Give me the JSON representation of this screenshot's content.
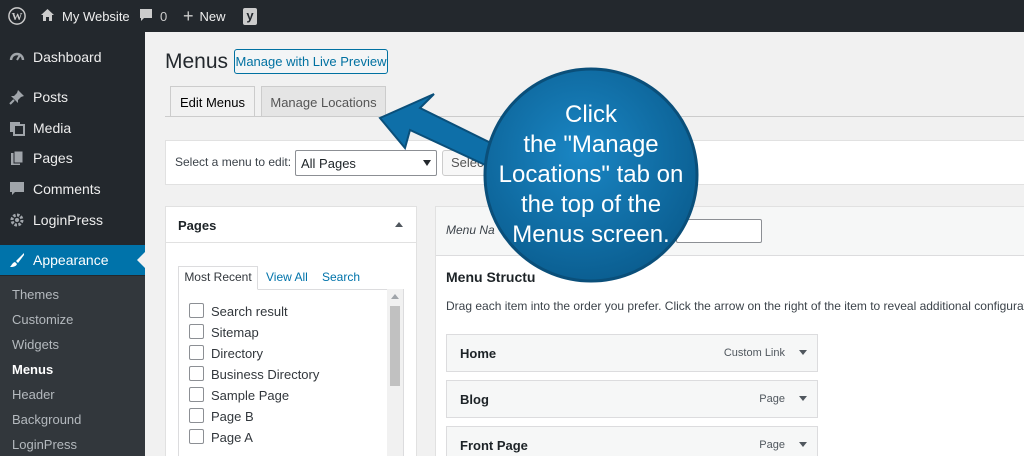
{
  "adminbar": {
    "site_name": "My Website",
    "comments_count": "0",
    "new_label": "New",
    "yoast_label": "y"
  },
  "sidebar": {
    "items": [
      {
        "label": "Dashboard",
        "icon": "dashboard-icon"
      },
      {
        "label": "Posts",
        "icon": "pin-icon"
      },
      {
        "label": "Media",
        "icon": "media-icon"
      },
      {
        "label": "Pages",
        "icon": "pages-icon"
      },
      {
        "label": "Comments",
        "icon": "comment-icon"
      },
      {
        "label": "LoginPress",
        "icon": "gear-icon"
      },
      {
        "label": "Appearance",
        "icon": "brush-icon"
      }
    ],
    "submenu": [
      "Themes",
      "Customize",
      "Widgets",
      "Menus",
      "Header",
      "Background",
      "LoginPress"
    ],
    "active_color": "#0073aa"
  },
  "main": {
    "title": "Menus",
    "live_preview_button": "Manage with Live Preview",
    "tabs": [
      "Edit Menus",
      "Manage Locations"
    ],
    "select_label": "Select a menu to edit:",
    "select_value": "All Pages",
    "select_button": "Select"
  },
  "pages_panel": {
    "title": "Pages",
    "tabs": [
      "Most Recent",
      "View All",
      "Search"
    ],
    "pages": [
      "Search result",
      "Sitemap",
      "Directory",
      "Business Directory",
      "Sample Page",
      "Page B",
      "Page A"
    ]
  },
  "menu_panel": {
    "menu_name_label": "Menu Na",
    "structure_title": "Menu Structu",
    "instructions": "Drag each item into the order you prefer. Click the arrow on the right of the item to reveal additional configuratio",
    "items": [
      {
        "title": "Home",
        "type": "Custom Link"
      },
      {
        "title": "Blog",
        "type": "Page"
      },
      {
        "title": "Front Page",
        "type": "Page"
      }
    ]
  },
  "callout": {
    "lines": [
      "Click",
      "the \"Manage",
      "Locations\" tab on",
      "the top of the",
      "Menus screen."
    ],
    "color": "#0e6fa8"
  }
}
